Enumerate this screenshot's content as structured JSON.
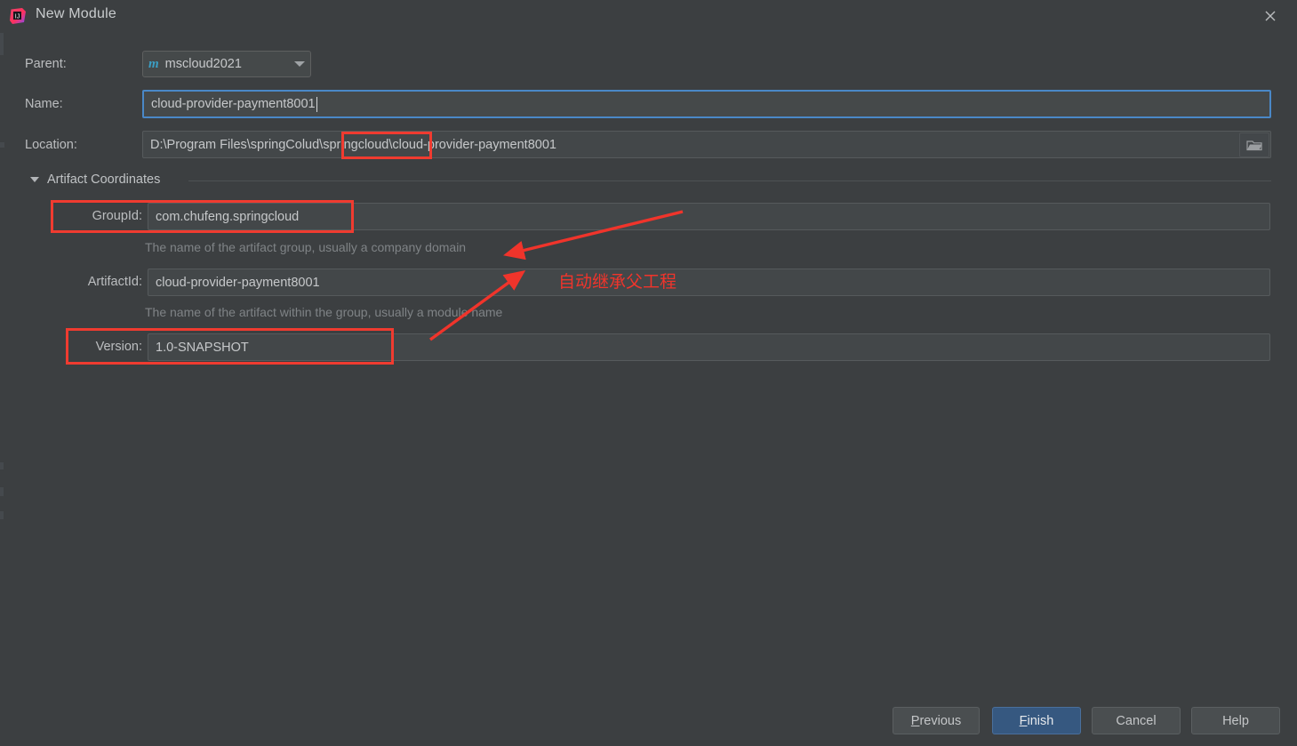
{
  "window": {
    "title": "New Module",
    "app_icon": "intellij-idea-icon",
    "close_icon": "close-icon",
    "background_color": "#3c3f41"
  },
  "form": {
    "parent": {
      "label": "Parent:",
      "value": "mscloud2021",
      "icon": "maven-module-icon",
      "dropdown_icon": "chevron-down-icon"
    },
    "name": {
      "label": "Name:",
      "value": "cloud-provider-payment8001",
      "focused": true
    },
    "location": {
      "label": "Location:",
      "value": "D:\\Program Files\\springColud\\springcloud\\cloud-provider-payment8001",
      "browse_icon": "folder-icon"
    }
  },
  "artifact_section": {
    "title": "Artifact Coordinates",
    "collapse_icon": "triangle-down-icon",
    "group_id": {
      "label": "GroupId:",
      "value": "com.chufeng.springcloud",
      "hint": "The name of the artifact group, usually a company domain"
    },
    "artifact_id": {
      "label": "ArtifactId:",
      "value": "cloud-provider-payment8001",
      "hint": "The name of the artifact within the group, usually a module name"
    },
    "version": {
      "label": "Version:",
      "value": "1.0-SNAPSHOT"
    }
  },
  "annotations": {
    "note_text": "自动继承父工程",
    "color": "#f0342b",
    "highlight_boxes": [
      "location-springcloud-segment",
      "group-id-row",
      "version-row"
    ]
  },
  "footer": {
    "previous": {
      "label": "Previous",
      "mnemonic": "P"
    },
    "finish": {
      "label": "Finish",
      "mnemonic": "F",
      "primary": true,
      "accent_color": "#365880"
    },
    "cancel": {
      "label": "Cancel"
    },
    "help": {
      "label": "Help"
    }
  }
}
